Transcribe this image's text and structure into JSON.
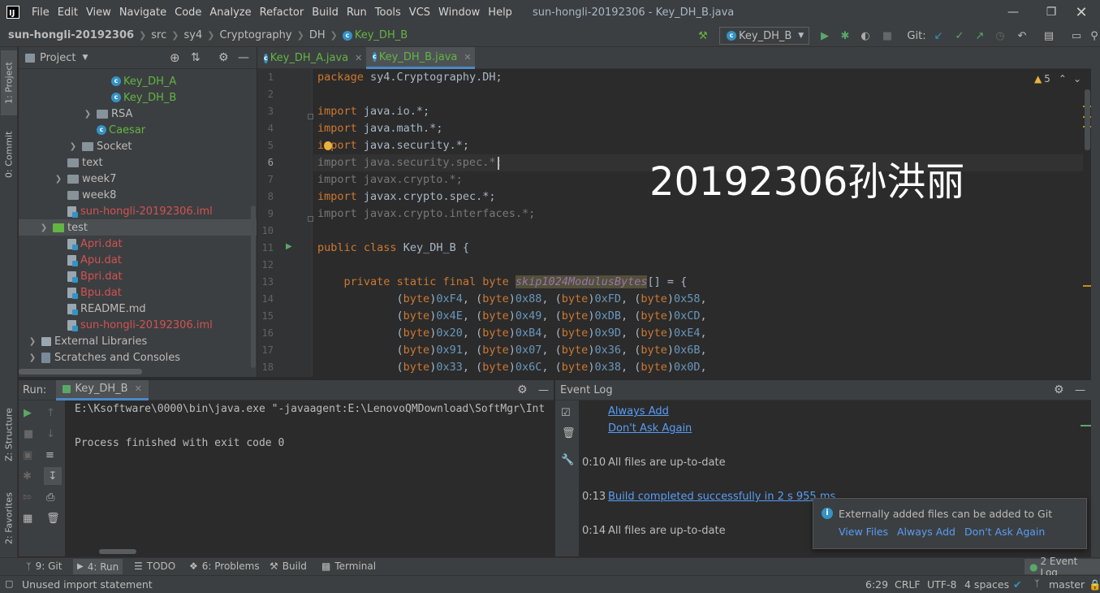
{
  "menu": [
    "File",
    "Edit",
    "View",
    "Navigate",
    "Code",
    "Analyze",
    "Refactor",
    "Build",
    "Run",
    "Tools",
    "VCS",
    "Window",
    "Help"
  ],
  "window_title": "sun-hongli-20192306 - Key_DH_B.java",
  "breadcrumb": [
    "sun-hongli-20192306",
    "src",
    "sy4",
    "Cryptography",
    "DH",
    "Key_DH_B"
  ],
  "run_config": "Key_DH_B",
  "git_label": "Git:",
  "left_tabs": {
    "project": "1: Project",
    "commit": "0: Commit",
    "structure": "Z: Structure",
    "favorites": "2: Favorites"
  },
  "project_panel": {
    "title": "Project",
    "tree": [
      {
        "label": "Key_DH_A",
        "type": "class",
        "color": "cyan"
      },
      {
        "label": "Key_DH_B",
        "type": "class",
        "color": "cyan"
      },
      {
        "label": "RSA",
        "type": "folder",
        "color": "normal"
      },
      {
        "label": "Caesar",
        "type": "class",
        "color": "cyan"
      },
      {
        "label": "Socket",
        "type": "folder",
        "color": "normal"
      },
      {
        "label": "text",
        "type": "folder",
        "color": "normal"
      },
      {
        "label": "week7",
        "type": "folder",
        "color": "normal"
      },
      {
        "label": "week8",
        "type": "folder",
        "color": "normal"
      },
      {
        "label": "sun-hongli-20192306.iml",
        "type": "file",
        "color": "red"
      },
      {
        "label": "test",
        "type": "folder-green",
        "color": "normal"
      },
      {
        "label": "Apri.dat",
        "type": "file",
        "color": "red"
      },
      {
        "label": "Apu.dat",
        "type": "file",
        "color": "red"
      },
      {
        "label": "Bpri.dat",
        "type": "file",
        "color": "red"
      },
      {
        "label": "Bpu.dat",
        "type": "file",
        "color": "red"
      },
      {
        "label": "README.md",
        "type": "file",
        "color": "normal"
      },
      {
        "label": "sun-hongli-20192306.iml",
        "type": "file",
        "color": "red"
      },
      {
        "label": "External Libraries",
        "type": "lib",
        "color": "normal"
      },
      {
        "label": "Scratches and Consoles",
        "type": "scratch",
        "color": "normal"
      }
    ]
  },
  "editor_tabs": [
    "Key_DH_A.java",
    "Key_DH_B.java"
  ],
  "inspection_count": "5",
  "code_lines": [
    {
      "n": "1",
      "text": "package sy4.Cryptography.DH;"
    },
    {
      "n": "2",
      "text": ""
    },
    {
      "n": "3",
      "text": "import java.io.*;"
    },
    {
      "n": "4",
      "text": "import java.math.*;"
    },
    {
      "n": "5",
      "text": "import java.security.*;"
    },
    {
      "n": "6",
      "text": "import java.security.spec.*;"
    },
    {
      "n": "7",
      "text": "import javax.crypto.*;"
    },
    {
      "n": "8",
      "text": "import javax.crypto.spec.*;"
    },
    {
      "n": "9",
      "text": "import javax.crypto.interfaces.*;"
    },
    {
      "n": "10",
      "text": ""
    },
    {
      "n": "11",
      "text": "public class Key_DH_B {"
    },
    {
      "n": "12",
      "text": ""
    },
    {
      "n": "13",
      "text": "    private static final byte skip1024ModulusBytes[] = {"
    },
    {
      "n": "14",
      "text": "            (byte)0xF4, (byte)0x88, (byte)0xFD, (byte)0x58,"
    },
    {
      "n": "15",
      "text": "            (byte)0x4E, (byte)0x49, (byte)0xDB, (byte)0xCD,"
    },
    {
      "n": "16",
      "text": "            (byte)0x20, (byte)0xB4, (byte)0x9D, (byte)0xE4,"
    },
    {
      "n": "17",
      "text": "            (byte)0x91, (byte)0x07, (byte)0x36, (byte)0x6B,"
    },
    {
      "n": "18",
      "text": "            (byte)0x33, (byte)0x6C, (byte)0x38, (byte)0x0D,"
    }
  ],
  "watermark": "20192306孙洪丽",
  "run_panel": {
    "label": "Run:",
    "tab": "Key_DH_B",
    "console": [
      "E:\\Ksoftware\\0000\\bin\\java.exe \"-javaagent:E:\\LenovoQMDownload\\SoftMgr\\Int",
      "",
      "Process finished with exit code 0"
    ]
  },
  "event_log": {
    "title": "Event Log",
    "entries": [
      {
        "time": "",
        "text": "Always Add",
        "link": true
      },
      {
        "time": "",
        "text": "Don't Ask Again",
        "link": true
      },
      {
        "time": "0:10",
        "text": "All files are up-to-date",
        "link": false
      },
      {
        "time": "0:13",
        "text": "Build completed successfully in 2 s 955 ms",
        "link": true
      },
      {
        "time": "0:14",
        "text": "All files are up-to-date",
        "link": false
      }
    ]
  },
  "notification": {
    "message": "Externally added files can be added to Git",
    "actions": [
      "View Files",
      "Always Add",
      "Don't Ask Again"
    ]
  },
  "bottom_tools": [
    "9: Git",
    "4: Run",
    "TODO",
    "6: Problems",
    "Build",
    "Terminal"
  ],
  "event_log_button": "2 Event Log",
  "status": {
    "message": "Unused import statement",
    "position": "6:29",
    "line_sep": "CRLF",
    "encoding": "UTF-8",
    "indent": "4 spaces",
    "branch": "master"
  },
  "colors": {
    "accent": "#4a88c7",
    "class_color": "#62b543",
    "error_file": "#d25252",
    "keyword": "#cc7832",
    "number": "#6897bb",
    "link": "#589df6"
  }
}
